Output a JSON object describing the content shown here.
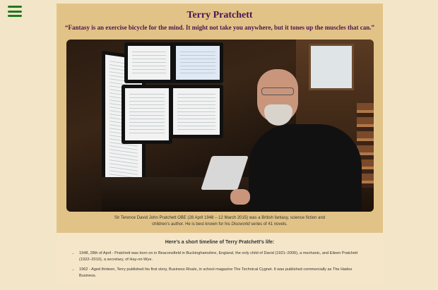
{
  "menu": {
    "icon": "hamburger-menu-icon",
    "color": "#1f7a1f"
  },
  "header": {
    "title": "Terry Pratchett",
    "quote": "“Fantasy is an exercise bicycle for the mind. It might not take you anywhere, but it tones up the muscles that can.”"
  },
  "figure": {
    "caption_text": "Sir Terence David John Pratchett OBE (28 April 1948 – 12 March 2015) was a British fantasy, science fiction and children’s author. He is best known for his",
    "caption_italic": "Discworld",
    "caption_tail": "series of 41 novels."
  },
  "timeline": {
    "title": "Here’s a short timeline of Terry Pratchett’s life:",
    "items": [
      "1948, 28th of April - Pratchett was born on in Beaconsfield in Buckinghamshire, England, the only child of David (1921–2006), a mechanic, and Eileen Pratchett (1922–2010), a secretary, of Hay-on-Wye.",
      "1962 - Aged thirteen, Terry published his first story, Business Rivals, in school magazine The Technical Cygnet. It was published commercially as The Hades Business."
    ]
  },
  "colors": {
    "accent": "#4b1450",
    "band": "#e2c387",
    "background": "#f3e5c8"
  }
}
